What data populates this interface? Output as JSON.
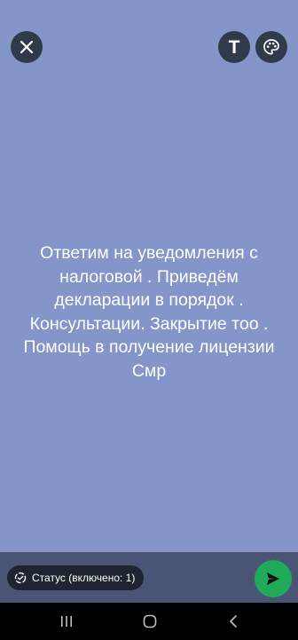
{
  "colors": {
    "background": "#8495c9",
    "top_button_bg": "#2f3a4a",
    "bottom_bar": "#4a5475",
    "chip_bg": "#1e2530",
    "send_button": "#1fab5a",
    "nav_bar": "#000000",
    "text": "#ffffff"
  },
  "top_bar": {
    "close_icon": "close-icon",
    "text_tool_label": "T",
    "palette_icon": "palette-icon"
  },
  "status": {
    "text": "Ответим на уведомления с налоговой . Приведём декларации в порядок . Консультации. Закрытие тоо . Помощь в получение лицензии Смр"
  },
  "composer": {
    "audience_icon": "status-ring-icon",
    "audience_label": "Статус (включено: 1)",
    "send_icon": "send-icon"
  },
  "nav": {
    "recents_icon": "recents-icon",
    "home_icon": "home-icon",
    "back_icon": "back-icon"
  }
}
